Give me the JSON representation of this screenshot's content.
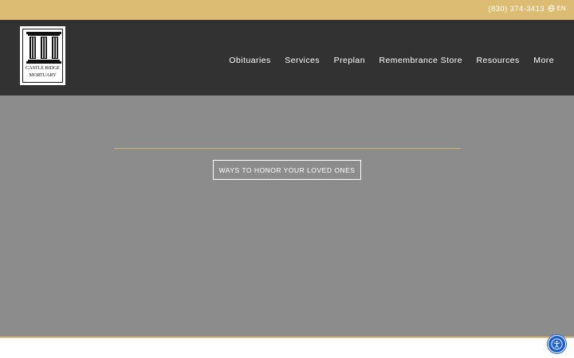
{
  "topbar": {
    "phone": "(830) 374-3413",
    "language": "EN",
    "language_icon": "globe-icon"
  },
  "logo": {
    "line1": "CASTLE RIDGE",
    "line2": "MORTUARY"
  },
  "nav": {
    "items": [
      "Obituaries",
      "Services",
      "Preplan",
      "Remembrance Store",
      "Resources",
      "More"
    ]
  },
  "hero": {
    "cta_label": "WAYS TO HONOR YOUR LOVED ONES"
  },
  "accessibility": {
    "icon": "accessibility-icon"
  },
  "colors": {
    "topbar": "#dcbc73",
    "header": "#323232",
    "hero": "#8c8c8c",
    "accent": "#dcbc73",
    "a11y_button": "#1b5fcf"
  }
}
